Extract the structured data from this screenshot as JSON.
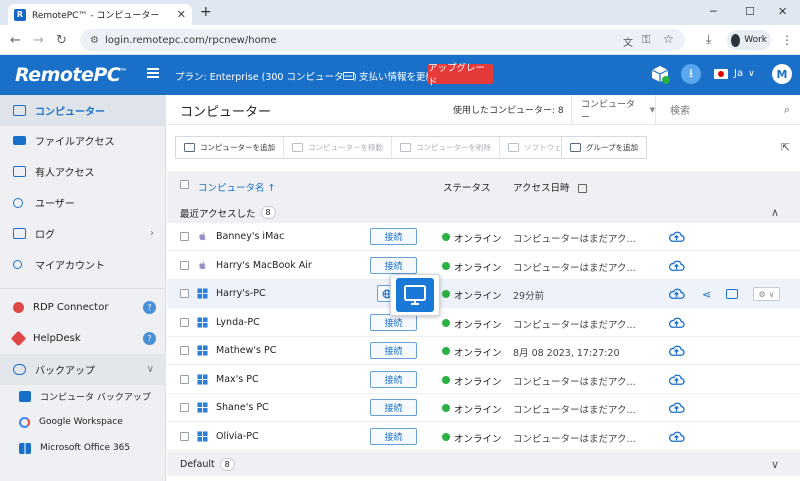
{
  "browser": {
    "tab_title": "RemotePC™ - コンピューター",
    "url": "login.remotepc.com/rpcnew/home",
    "profile": "Work",
    "profile_initial": "M"
  },
  "header": {
    "logo": "RemotePC",
    "logo_tm": "™",
    "plan": "プラン: Enterprise (300 コンピューター)",
    "billing": "支払い情報を更新",
    "upgrade": "アップグレード",
    "lang": "Ja",
    "user_initial": "M"
  },
  "sidebar": {
    "items": [
      {
        "label": "コンピューター",
        "icon": "monitor-icon",
        "active": true
      },
      {
        "label": "ファイルアクセス",
        "icon": "drive-icon"
      },
      {
        "label": "有人アクセス",
        "icon": "screen-share-icon"
      },
      {
        "label": "ユーザー",
        "icon": "users-icon"
      },
      {
        "label": "ログ",
        "icon": "log-icon"
      },
      {
        "label": "マイアカウント",
        "icon": "account-icon"
      },
      {
        "label": "RDP Connector",
        "icon": "rdp-icon"
      },
      {
        "label": "HelpDesk",
        "icon": "helpdesk-icon"
      },
      {
        "label": "バックアップ",
        "icon": "cloud-backup-icon"
      }
    ],
    "backup_sub": [
      {
        "label": "コンピュータ バックアップ",
        "icon": "computer-backup-icon"
      },
      {
        "label": "Google Workspace",
        "icon": "google-icon"
      },
      {
        "label": "Microsoft Office 365",
        "icon": "windows-icon"
      }
    ]
  },
  "main": {
    "title": "コンピューター",
    "used": "使用したコンピューター: 8",
    "computer_filter": "コンピューター",
    "search_placeholder": "検索",
    "toolbar": {
      "add": "コンピューターを追加",
      "move": "コンピューターを移動",
      "delete": "コンピューターを削除",
      "software": "ソフトウェアを更新",
      "add_group": "グループを追加"
    },
    "columns": {
      "name": "コンピュータ名",
      "name_sort": "↑",
      "status": "ステータス",
      "access": "アクセス日時"
    },
    "groups": [
      {
        "label": "最近アクセスした",
        "count": "8"
      },
      {
        "label": "Default",
        "count": "8"
      }
    ],
    "rows": [
      {
        "name": "Banney's iMac",
        "os": "apple",
        "connect": "接続",
        "status": "オンライン",
        "access": "コンピューターはまだアク..."
      },
      {
        "name": "Harry's MacBook Air",
        "os": "apple",
        "connect": "接続",
        "status": "オンライン",
        "access": "コンピューターはまだアク..."
      },
      {
        "name": "Harry's-PC",
        "os": "windows",
        "connect": "",
        "status": "オンライン",
        "access": "29分前"
      },
      {
        "name": "Lynda-PC",
        "os": "windows",
        "connect": "接続",
        "status": "オンライン",
        "access": "コンピューターはまだアク..."
      },
      {
        "name": "Mathew's PC",
        "os": "windows",
        "connect": "接続",
        "status": "オンライン",
        "access": "8月 08 2023, 17:27:20"
      },
      {
        "name": "Max's PC",
        "os": "windows",
        "connect": "接続",
        "status": "オンライン",
        "access": "コンピューターはまだアク..."
      },
      {
        "name": "Shane's PC",
        "os": "windows",
        "connect": "接続",
        "status": "オンライン",
        "access": "コンピューターはまだアク..."
      },
      {
        "name": "Olivia-PC",
        "os": "windows",
        "connect": "接続",
        "status": "オンライン",
        "access": "コンピューターはまだアク..."
      }
    ]
  },
  "colors": {
    "brand": "#1a70c8",
    "upgrade": "#e53a3a",
    "online": "#2bb043"
  }
}
